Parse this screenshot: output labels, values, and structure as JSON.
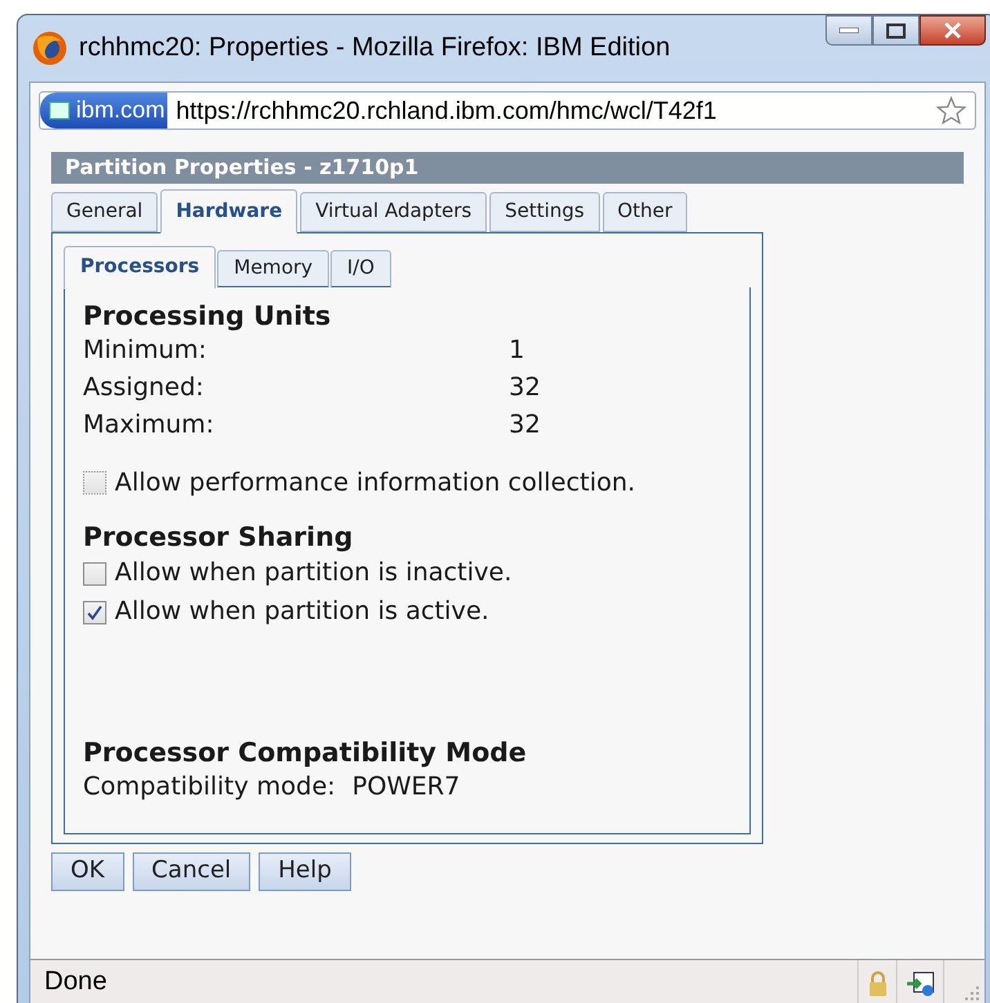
{
  "window": {
    "title": "rchhmc20: Properties - Mozilla Firefox: IBM Edition"
  },
  "address_bar": {
    "site": "ibm.com",
    "url": "https://rchhmc20.rchland.ibm.com/hmc/wcl/T42f1"
  },
  "panel_title": "Partition Properties - z1710p1",
  "tabs": [
    {
      "label": "General",
      "selected": false
    },
    {
      "label": "Hardware",
      "selected": true
    },
    {
      "label": "Virtual Adapters",
      "selected": false
    },
    {
      "label": "Settings",
      "selected": false
    },
    {
      "label": "Other",
      "selected": false
    }
  ],
  "subtabs": [
    {
      "label": "Processors",
      "selected": true
    },
    {
      "label": "Memory",
      "selected": false
    },
    {
      "label": "I/O",
      "selected": false
    }
  ],
  "processing_units": {
    "heading": "Processing Units",
    "rows": [
      {
        "label": "Minimum:",
        "value": "1"
      },
      {
        "label": "Assigned:",
        "value": "32"
      },
      {
        "label": "Maximum:",
        "value": "32"
      }
    ]
  },
  "performance_checkbox": {
    "label": "Allow performance information collection.",
    "checked": false,
    "disabled": true
  },
  "processor_sharing": {
    "heading": "Processor Sharing",
    "options": [
      {
        "label": "Allow when partition is inactive.",
        "checked": false
      },
      {
        "label": "Allow when partition is active.",
        "checked": true
      }
    ]
  },
  "compatibility": {
    "heading": "Processor Compatibility Mode",
    "label": "Compatibility mode:",
    "value": "POWER7"
  },
  "buttons": [
    "OK",
    "Cancel",
    "Help"
  ],
  "status_bar": {
    "text": "Done"
  }
}
